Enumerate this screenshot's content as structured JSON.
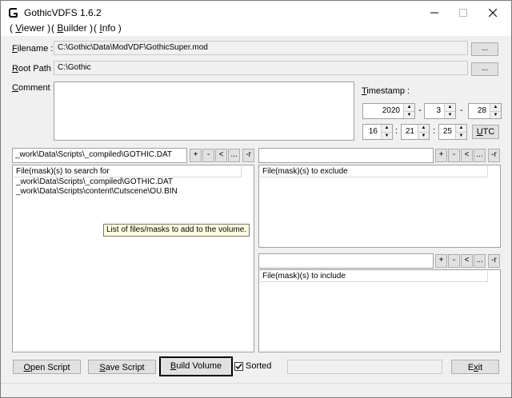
{
  "window": {
    "title": "GothicVDFS 1.6.2"
  },
  "menu": [
    {
      "pre": "( ",
      "key": "V",
      "rest": "iewer )"
    },
    {
      "pre": "( ",
      "key": "B",
      "rest": "uilder )"
    },
    {
      "pre": "( ",
      "key": "I",
      "rest": "nfo )"
    }
  ],
  "form": {
    "filename": {
      "label_key": "F",
      "label_rest": "ilename :",
      "value": "C:\\Gothic\\Data\\ModVDF\\GothicSuper.mod"
    },
    "root_path": {
      "label_key": "R",
      "label_rest": "oot Path :",
      "value": "C:\\Gothic"
    },
    "comment": {
      "label_key": "C",
      "label_rest": "omment :",
      "value": ""
    },
    "browse_label": "..."
  },
  "timestamp": {
    "label_key": "T",
    "label_rest": "imestamp :",
    "year": "2020",
    "month": "3",
    "day": "28",
    "hour": "16",
    "minute": "21",
    "second": "25",
    "date_sep": "-",
    "time_sep": ":",
    "utc_key": "U",
    "utc_rest": "TC"
  },
  "search_panel": {
    "path": "_work\\Data\\Scripts\\_compiled\\GOTHIC.DAT",
    "header": "File(mask)(s) to search for",
    "items": [
      "_work\\Data\\Scripts\\_compiled\\GOTHIC.DAT",
      "_work\\Data\\Scripts\\content\\Cutscene\\OU.BIN"
    ]
  },
  "exclude_panel": {
    "path": "",
    "header": "File(mask)(s) to exclude"
  },
  "include_panel": {
    "path": "",
    "header": "File(mask)(s) to include"
  },
  "list_buttons": {
    "add": "+",
    "remove": "-",
    "pick": "<",
    "browse": "...",
    "recursive": "-r"
  },
  "tooltip": "List of files/masks to add to the volume.",
  "bottom": {
    "open_key": "O",
    "open_rest": "pen Script",
    "save_key": "S",
    "save_rest": "ave Script",
    "build_key": "B",
    "build_rest": "uild Volume",
    "sorted_label": "Sorted",
    "sorted_checked": true,
    "exit_pre": "E",
    "exit_key": "x",
    "exit_rest": "it",
    "status": ""
  },
  "icons": {
    "app": "gothic-g-icon",
    "minimize": "minimize-icon",
    "maximize": "maximize-icon",
    "close": "close-icon",
    "check": "checkmark-icon"
  }
}
